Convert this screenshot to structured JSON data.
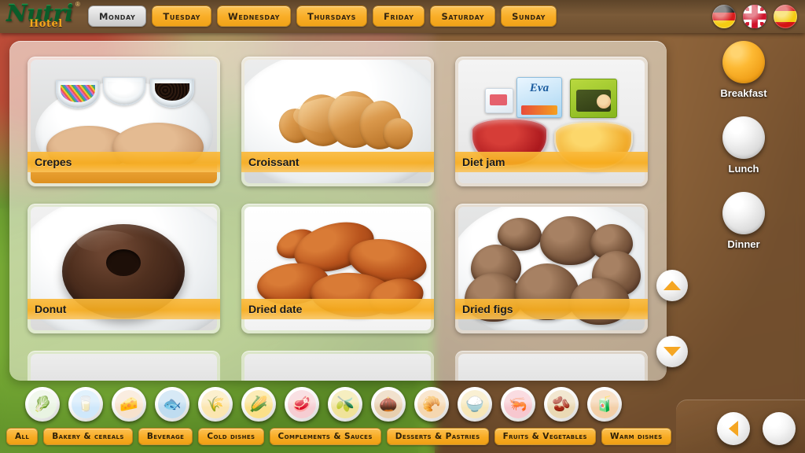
{
  "app": {
    "brand_name": "Nutri",
    "brand_sub": "Hotel",
    "brand_reg": "®"
  },
  "colors": {
    "accent_orange": "#f8ab23",
    "accent_orange_light": "#fcc255",
    "label_banner": "#f7ac1d",
    "selected_tab_bg": "#dcdcdc",
    "wood_brown": "#6b4a2b",
    "text_dark": "#1a1a1a",
    "panel_overlay": "rgba(248,246,236,0.6)"
  },
  "days": {
    "items": [
      {
        "label": "Monday",
        "selected": true
      },
      {
        "label": "Tuesday",
        "selected": false
      },
      {
        "label": "Wednesday",
        "selected": false
      },
      {
        "label": "Thursdays",
        "selected": false
      },
      {
        "label": "Friday",
        "selected": false
      },
      {
        "label": "Saturday",
        "selected": false
      },
      {
        "label": "Sunday",
        "selected": false
      }
    ]
  },
  "languages": {
    "items": [
      {
        "name": "german-flag",
        "code": "de"
      },
      {
        "name": "english-flag",
        "code": "gb"
      },
      {
        "name": "spanish-flag",
        "code": "es"
      }
    ]
  },
  "meals": {
    "items": [
      {
        "label": "Breakfast",
        "selected": true
      },
      {
        "label": "Lunch",
        "selected": false
      },
      {
        "label": "Dinner",
        "selected": false
      }
    ]
  },
  "dishes": {
    "items": [
      {
        "label": "Crepes",
        "image": "crepes-photo"
      },
      {
        "label": "Croissant",
        "image": "croissant-photo"
      },
      {
        "label": "Diet jam",
        "image": "diet-jam-photo"
      },
      {
        "label": "Donut",
        "image": "donut-photo"
      },
      {
        "label": "Dried date",
        "image": "dried-date-photo"
      },
      {
        "label": "Dried figs",
        "image": "dried-figs-photo"
      }
    ],
    "partial_row_count": 3
  },
  "category_icons": {
    "items": [
      {
        "name": "vegetables-icon",
        "glyph": "🥬",
        "bg": "#e9f4e2"
      },
      {
        "name": "beverage-icon",
        "glyph": "🥛",
        "bg": "#cfe8fb"
      },
      {
        "name": "eggs-cheese-icon",
        "glyph": "🧀",
        "bg": "#f7e2cd"
      },
      {
        "name": "fish-icon",
        "glyph": "🐟",
        "bg": "#bfdcf0"
      },
      {
        "name": "cereals-icon",
        "glyph": "🌾",
        "bg": "#fbe6b0"
      },
      {
        "name": "corn-icon",
        "glyph": "🌽",
        "bg": "#fbe089"
      },
      {
        "name": "meat-icon",
        "glyph": "🥩",
        "bg": "#f6cdd2"
      },
      {
        "name": "oil-icon",
        "glyph": "🫒",
        "bg": "#f0e39a"
      },
      {
        "name": "nuts-icon",
        "glyph": "🌰",
        "bg": "#e8cfae"
      },
      {
        "name": "pastries-icon",
        "glyph": "🥐",
        "bg": "#f5d7b0"
      },
      {
        "name": "grains-icon",
        "glyph": "🍚",
        "bg": "#f7e7b8"
      },
      {
        "name": "seafood-icon",
        "glyph": "🦐",
        "bg": "#f7c7cf"
      },
      {
        "name": "legumes-icon",
        "glyph": "🫘",
        "bg": "#ead9b4"
      },
      {
        "name": "products-icon",
        "glyph": "🧃",
        "bg": "#f3cfa8"
      }
    ]
  },
  "filters": {
    "items": [
      {
        "label": "All",
        "selected": false
      },
      {
        "label": "Bakery & cereals",
        "selected": false
      },
      {
        "label": "Beverage",
        "selected": false
      },
      {
        "label": "Cold dishes",
        "selected": false
      },
      {
        "label": "Complements & Sauces",
        "selected": false
      },
      {
        "label": "Desserts & Pastries",
        "selected": false
      },
      {
        "label": "Fruits & Vegetables",
        "selected": false
      },
      {
        "label": "Warm dishes",
        "selected": false
      }
    ]
  },
  "controls": {
    "scroll_up": "scroll-up-arrow",
    "scroll_down": "scroll-down-arrow",
    "back": "back-arrow",
    "home": "home-button"
  }
}
